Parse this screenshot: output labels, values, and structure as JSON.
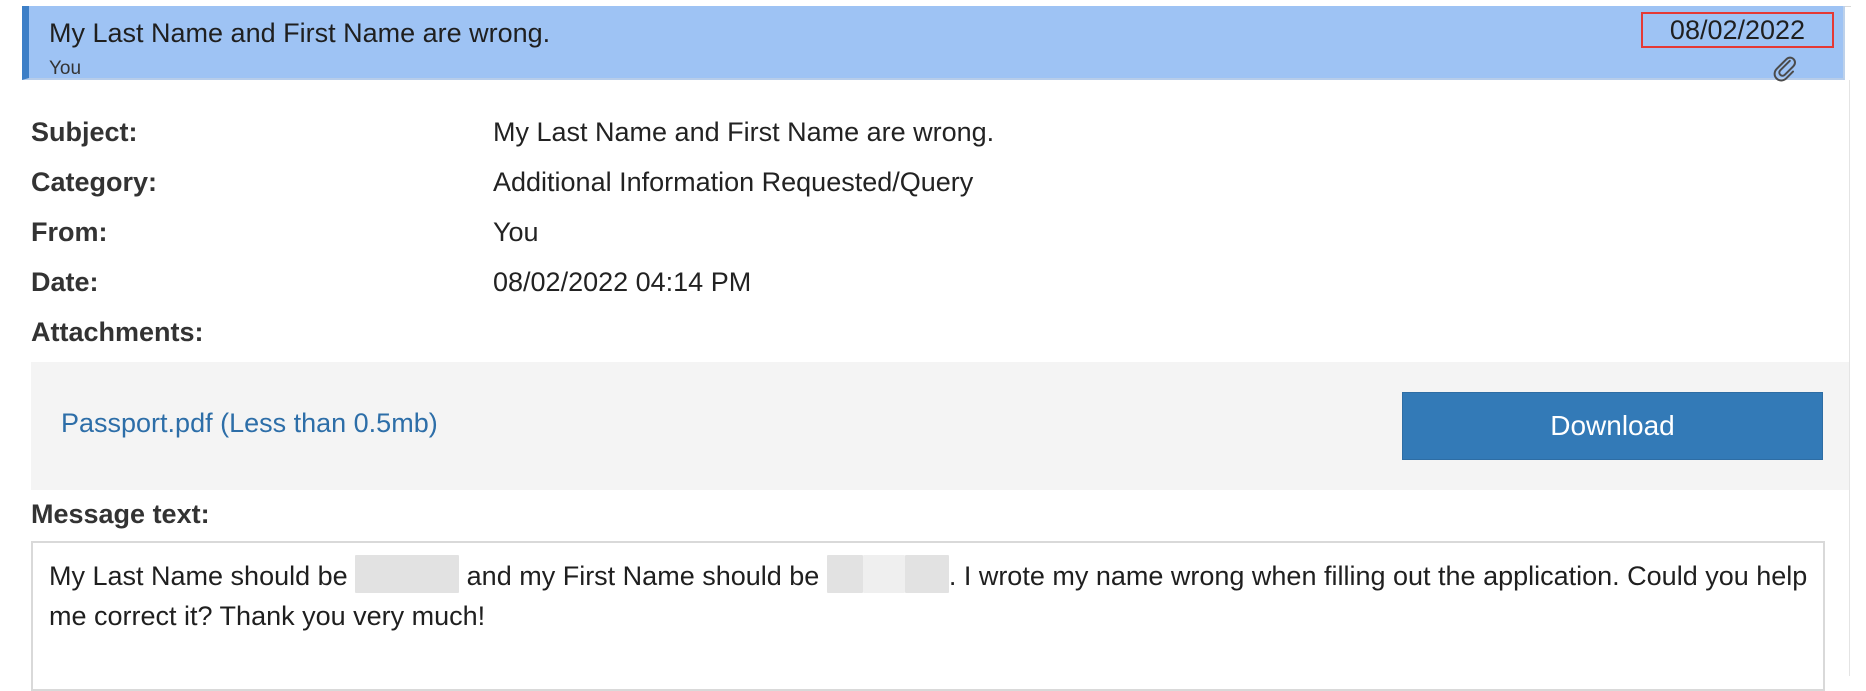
{
  "message_header": {
    "subject": "My Last Name and First Name are wrong.",
    "sender": "You",
    "date": "08/02/2022",
    "attachment_icon": "paperclip-icon"
  },
  "details": {
    "subject_label": "Subject:",
    "subject_value": "My Last Name and First Name are wrong.",
    "category_label": "Category:",
    "category_value": "Additional Information Requested/Query",
    "from_label": "From:",
    "from_value": "You",
    "date_label": "Date:",
    "date_value": "08/02/2022 04:14 PM",
    "attachments_label": "Attachments:"
  },
  "attachment": {
    "file_label": "Passport.pdf (Less than 0.5mb)",
    "download_label": "Download"
  },
  "message": {
    "label": "Message text:",
    "part1": "My Last Name should be ",
    "part2": " and my First Name should be ",
    "part3": ". I wrote my name wrong when filling out the application. Could you help me correct it? Thank you very much!"
  },
  "colors": {
    "header_background": "#9ec3f4",
    "header_accent": "#3d7fc7",
    "date_highlight": "#e53935",
    "link": "#2d6ea8",
    "button": "#337ab7",
    "panel": "#f4f4f4"
  }
}
